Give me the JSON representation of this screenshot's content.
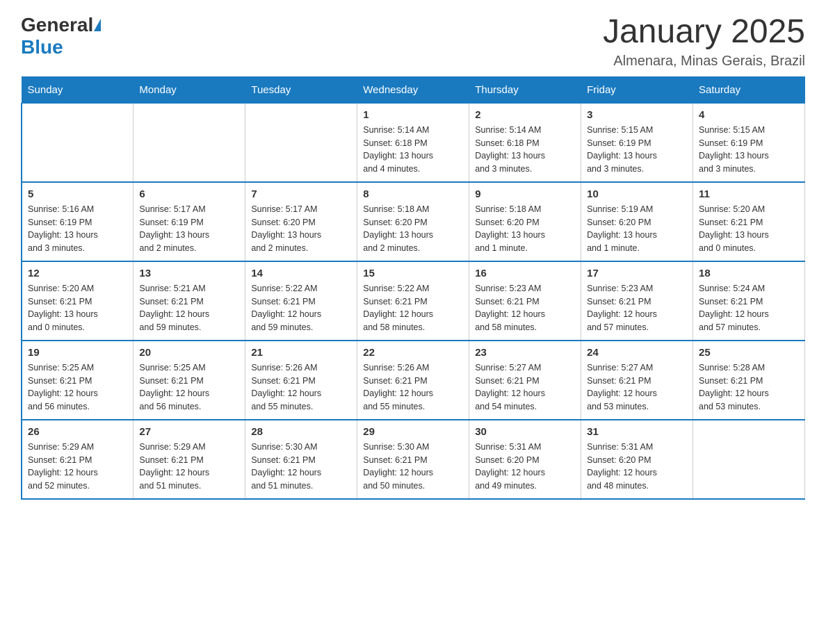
{
  "header": {
    "logo_general": "General",
    "logo_blue": "Blue",
    "title": "January 2025",
    "subtitle": "Almenara, Minas Gerais, Brazil"
  },
  "calendar": {
    "days_of_week": [
      "Sunday",
      "Monday",
      "Tuesday",
      "Wednesday",
      "Thursday",
      "Friday",
      "Saturday"
    ],
    "weeks": [
      [
        {
          "day": "",
          "info": ""
        },
        {
          "day": "",
          "info": ""
        },
        {
          "day": "",
          "info": ""
        },
        {
          "day": "1",
          "info": "Sunrise: 5:14 AM\nSunset: 6:18 PM\nDaylight: 13 hours\nand 4 minutes."
        },
        {
          "day": "2",
          "info": "Sunrise: 5:14 AM\nSunset: 6:18 PM\nDaylight: 13 hours\nand 3 minutes."
        },
        {
          "day": "3",
          "info": "Sunrise: 5:15 AM\nSunset: 6:19 PM\nDaylight: 13 hours\nand 3 minutes."
        },
        {
          "day": "4",
          "info": "Sunrise: 5:15 AM\nSunset: 6:19 PM\nDaylight: 13 hours\nand 3 minutes."
        }
      ],
      [
        {
          "day": "5",
          "info": "Sunrise: 5:16 AM\nSunset: 6:19 PM\nDaylight: 13 hours\nand 3 minutes."
        },
        {
          "day": "6",
          "info": "Sunrise: 5:17 AM\nSunset: 6:19 PM\nDaylight: 13 hours\nand 2 minutes."
        },
        {
          "day": "7",
          "info": "Sunrise: 5:17 AM\nSunset: 6:20 PM\nDaylight: 13 hours\nand 2 minutes."
        },
        {
          "day": "8",
          "info": "Sunrise: 5:18 AM\nSunset: 6:20 PM\nDaylight: 13 hours\nand 2 minutes."
        },
        {
          "day": "9",
          "info": "Sunrise: 5:18 AM\nSunset: 6:20 PM\nDaylight: 13 hours\nand 1 minute."
        },
        {
          "day": "10",
          "info": "Sunrise: 5:19 AM\nSunset: 6:20 PM\nDaylight: 13 hours\nand 1 minute."
        },
        {
          "day": "11",
          "info": "Sunrise: 5:20 AM\nSunset: 6:21 PM\nDaylight: 13 hours\nand 0 minutes."
        }
      ],
      [
        {
          "day": "12",
          "info": "Sunrise: 5:20 AM\nSunset: 6:21 PM\nDaylight: 13 hours\nand 0 minutes."
        },
        {
          "day": "13",
          "info": "Sunrise: 5:21 AM\nSunset: 6:21 PM\nDaylight: 12 hours\nand 59 minutes."
        },
        {
          "day": "14",
          "info": "Sunrise: 5:22 AM\nSunset: 6:21 PM\nDaylight: 12 hours\nand 59 minutes."
        },
        {
          "day": "15",
          "info": "Sunrise: 5:22 AM\nSunset: 6:21 PM\nDaylight: 12 hours\nand 58 minutes."
        },
        {
          "day": "16",
          "info": "Sunrise: 5:23 AM\nSunset: 6:21 PM\nDaylight: 12 hours\nand 58 minutes."
        },
        {
          "day": "17",
          "info": "Sunrise: 5:23 AM\nSunset: 6:21 PM\nDaylight: 12 hours\nand 57 minutes."
        },
        {
          "day": "18",
          "info": "Sunrise: 5:24 AM\nSunset: 6:21 PM\nDaylight: 12 hours\nand 57 minutes."
        }
      ],
      [
        {
          "day": "19",
          "info": "Sunrise: 5:25 AM\nSunset: 6:21 PM\nDaylight: 12 hours\nand 56 minutes."
        },
        {
          "day": "20",
          "info": "Sunrise: 5:25 AM\nSunset: 6:21 PM\nDaylight: 12 hours\nand 56 minutes."
        },
        {
          "day": "21",
          "info": "Sunrise: 5:26 AM\nSunset: 6:21 PM\nDaylight: 12 hours\nand 55 minutes."
        },
        {
          "day": "22",
          "info": "Sunrise: 5:26 AM\nSunset: 6:21 PM\nDaylight: 12 hours\nand 55 minutes."
        },
        {
          "day": "23",
          "info": "Sunrise: 5:27 AM\nSunset: 6:21 PM\nDaylight: 12 hours\nand 54 minutes."
        },
        {
          "day": "24",
          "info": "Sunrise: 5:27 AM\nSunset: 6:21 PM\nDaylight: 12 hours\nand 53 minutes."
        },
        {
          "day": "25",
          "info": "Sunrise: 5:28 AM\nSunset: 6:21 PM\nDaylight: 12 hours\nand 53 minutes."
        }
      ],
      [
        {
          "day": "26",
          "info": "Sunrise: 5:29 AM\nSunset: 6:21 PM\nDaylight: 12 hours\nand 52 minutes."
        },
        {
          "day": "27",
          "info": "Sunrise: 5:29 AM\nSunset: 6:21 PM\nDaylight: 12 hours\nand 51 minutes."
        },
        {
          "day": "28",
          "info": "Sunrise: 5:30 AM\nSunset: 6:21 PM\nDaylight: 12 hours\nand 51 minutes."
        },
        {
          "day": "29",
          "info": "Sunrise: 5:30 AM\nSunset: 6:21 PM\nDaylight: 12 hours\nand 50 minutes."
        },
        {
          "day": "30",
          "info": "Sunrise: 5:31 AM\nSunset: 6:20 PM\nDaylight: 12 hours\nand 49 minutes."
        },
        {
          "day": "31",
          "info": "Sunrise: 5:31 AM\nSunset: 6:20 PM\nDaylight: 12 hours\nand 48 minutes."
        },
        {
          "day": "",
          "info": ""
        }
      ]
    ]
  }
}
